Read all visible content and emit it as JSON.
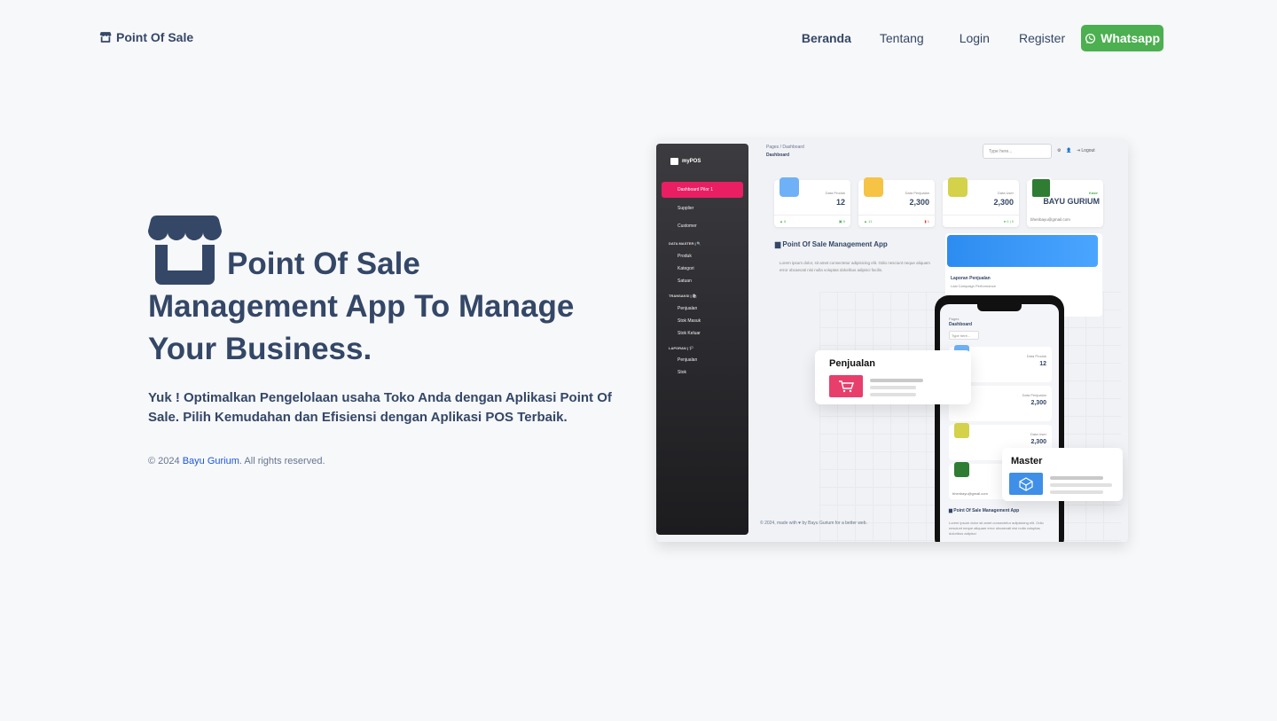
{
  "nav": {
    "brand": "Point Of Sale",
    "links": [
      "Beranda",
      "Tentang",
      "Login",
      "Register"
    ],
    "whatsapp": "Whatsapp"
  },
  "hero": {
    "title_line1": "Point Of Sale",
    "title_line2": "Management App To Manage",
    "title_line3": "Your Business.",
    "subtitle": "Yuk ! Optimalkan Pengelolaan usaha Toko Anda dengan Aplikasi Point Of Sale. Pilih Kemudahan dan Efisiensi dengan Aplikasi POS Terbaik.",
    "copyright_prefix": "© 2024",
    "copyright_author": "Bayu Gurium",
    "copyright_suffix": ". All rights reserved."
  },
  "mockup": {
    "sidebar": {
      "logo": "myPOS",
      "active": "Dashboard Pilor 1",
      "items": [
        "Supplier",
        "Customer"
      ],
      "section_master": "DATA MASTER | 🔍",
      "master_items": [
        "Produk",
        "Kategori",
        "Satuan"
      ],
      "section_transaksi": "TRANSAKSI | 🛍",
      "transaksi_items": [
        "Penjualan",
        "Stok Masuk",
        "Stok Keluar"
      ],
      "section_laporan": "LAPORAN | 🏳",
      "laporan_items": [
        "Penjualan",
        "Stok"
      ]
    },
    "breadcrumb": "Pages  /  Dashboard",
    "page_title": "Dashboard",
    "search_placeholder": "Type here...",
    "logout": "Logout",
    "cards": [
      {
        "label": "Data Produk",
        "value": "12",
        "foot_left": "6",
        "foot_right": "5",
        "color": "#6fb1f7"
      },
      {
        "label": "Data Penjualan",
        "value": "2,300",
        "foot_left": "11",
        "foot_right": "1",
        "color": "#f6c344"
      },
      {
        "label": "Data User",
        "value": "2,300",
        "foot_left": "0 | 0",
        "foot_right": "0",
        "color": "#d4d14a"
      }
    ],
    "user": {
      "role": "Kasir",
      "name": "BAYU GURIUM",
      "email": "bhenbayu@gmail.com"
    },
    "app_title": "Point Of Sale Management App",
    "app_desc": "Lorem ipsum dolor, sit amet consectetur adipisicing elit. Odio nesciunt neque aliquam error obcaecati nisi nulla voluptas doloribus adipisci facilis.",
    "report_title": "Laporan Penjualan",
    "report_sub": "Last Campaign Performance",
    "footer": "© 2024, made with ♥ by Bayu Gurium for a better web.",
    "float_penjualan": "Penjualan",
    "float_master": "Master",
    "phone": {
      "crumb": "Pages",
      "title": "Dashboard",
      "search": "Type here...",
      "email": "bhenbayu@gmail.com",
      "app_title": "Point Of Sale Management App",
      "desc": "Lorem ipsum dolor sit amet consectetur adipisicing elit. Odio nesciunt neque aliquam error obcaecati nisi nulla voluptas doloribus adipisci"
    }
  },
  "colors": {
    "primary": "#344767",
    "whatsapp": "#4caf50",
    "pink": "#e91e63",
    "blue": "#2d8cf0"
  }
}
